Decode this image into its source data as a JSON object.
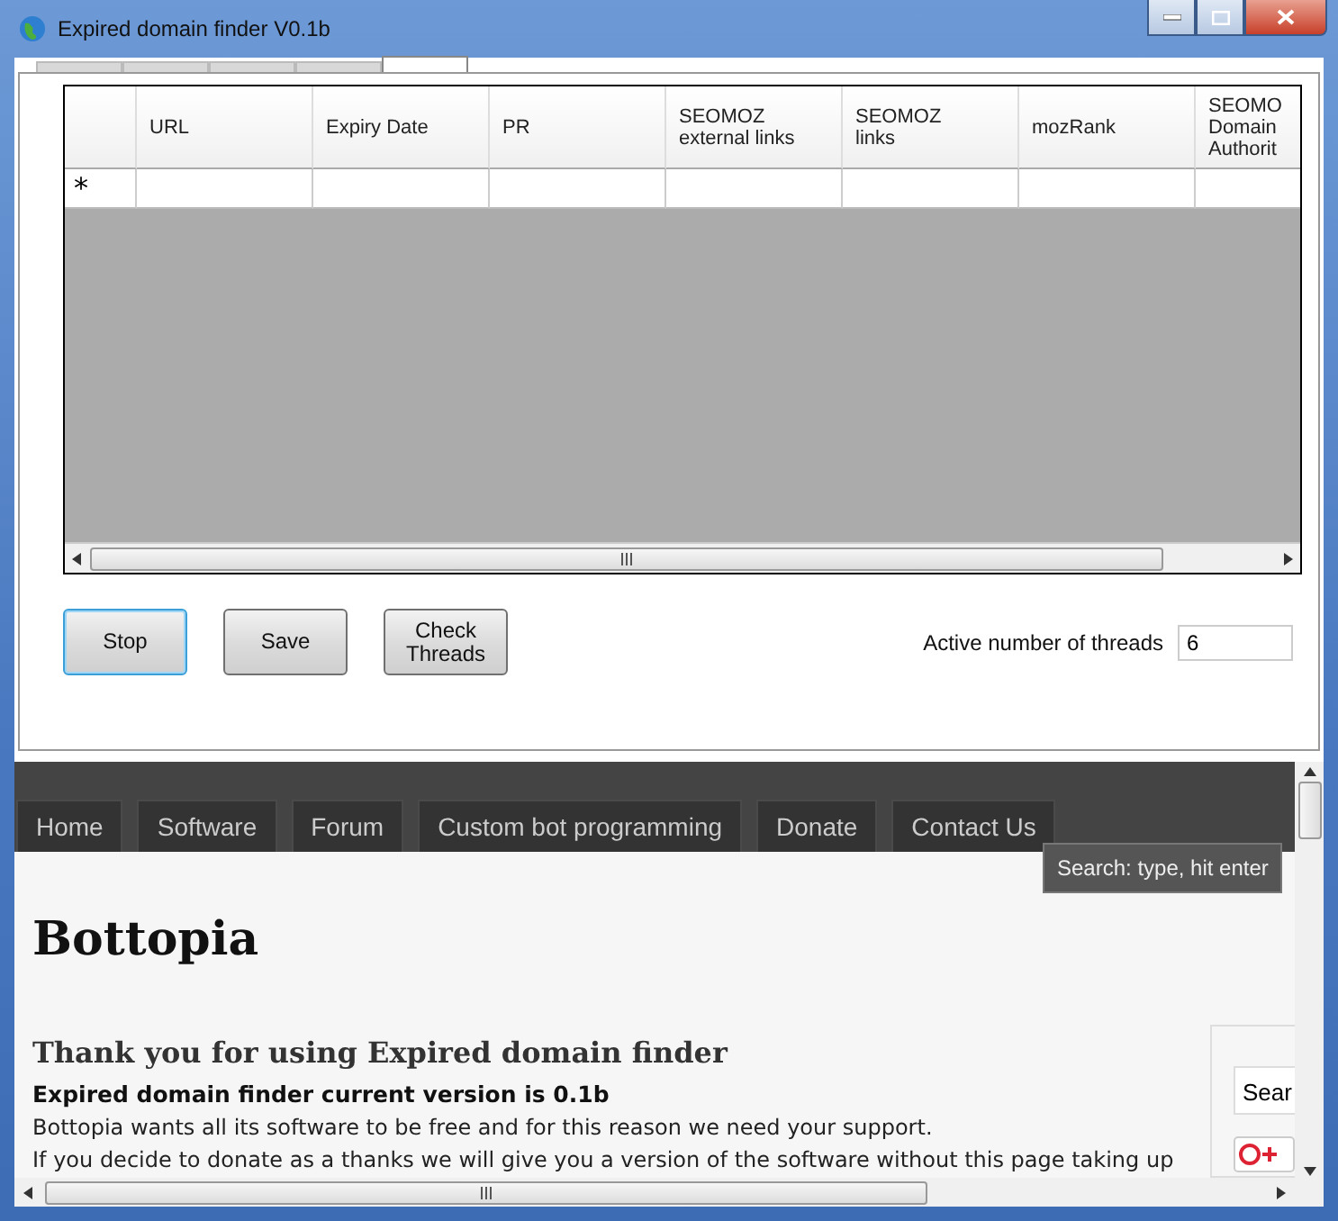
{
  "window": {
    "title": "Expired domain finder V0.1b"
  },
  "tabs": [
    {
      "selected": false
    },
    {
      "selected": false
    },
    {
      "selected": false
    },
    {
      "selected": false
    },
    {
      "selected": true
    }
  ],
  "grid": {
    "columns": [
      "URL",
      "Expiry Date",
      "PR",
      "SEOMOZ\nexternal links",
      "SEOMOZ\nlinks",
      "mozRank",
      "SEOMO\nDomain\nAuthorit"
    ],
    "new_row_marker": "*"
  },
  "buttons": [
    {
      "label": "Stop",
      "focused": true
    },
    {
      "label": "Save",
      "focused": false
    },
    {
      "label": "Check\nThreads",
      "focused": false
    }
  ],
  "threads": {
    "label": "Active number of threads",
    "value": "6"
  },
  "browser": {
    "nav": [
      "Home",
      "Software",
      "Forum",
      "Custom bot programming",
      "Donate",
      "Contact Us"
    ],
    "tooltip": "Search: type, hit enter",
    "site_title": "Bottopia",
    "heading": "Thank you for using Expired domain finder",
    "version_line": "Expired domain finder current version is 0.1b",
    "paragraphs": [
      "Bottopia wants all its software to be free and for this reason we need your support.",
      "If you decide to donate as a thanks we will give you a version of the software without this page taking up"
    ],
    "sidebar": {
      "search_value": "Sear"
    }
  }
}
